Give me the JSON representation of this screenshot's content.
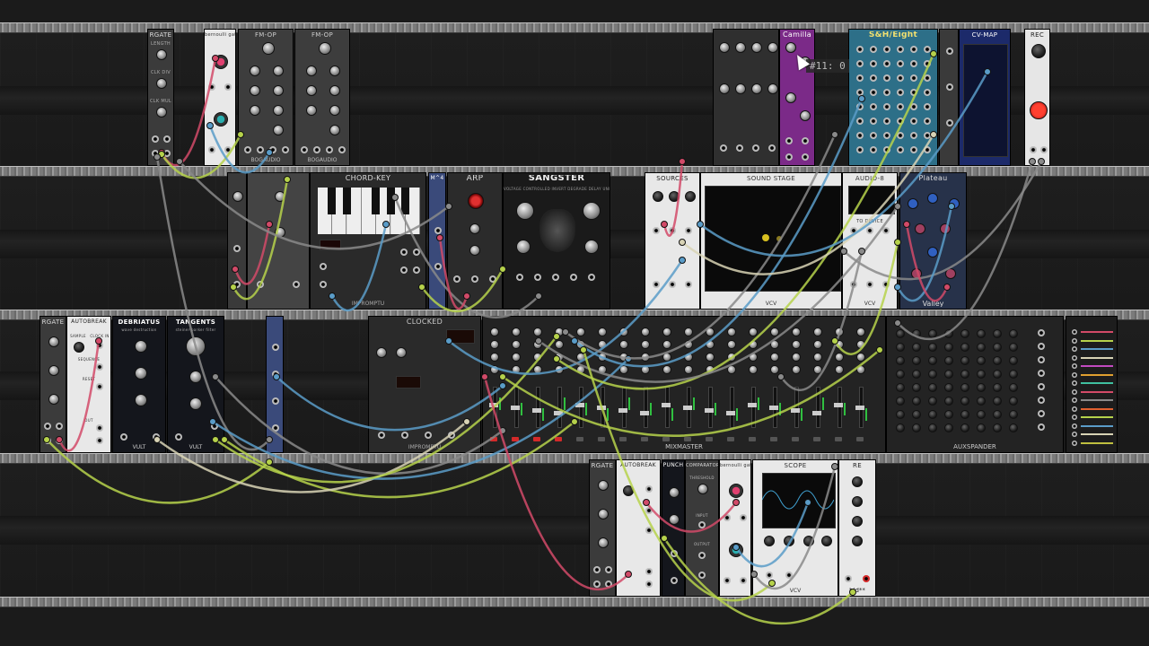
{
  "colors": {
    "cable_red": "#d24a68",
    "cable_green": "#b6d24b",
    "cable_blue": "#5a9cc8",
    "cable_grey": "#8a8a8a",
    "cable_cream": "#d8d3b5",
    "purple": "#7b2a88",
    "red": "#d42a2a"
  },
  "tooltip": "#11: 0",
  "modules": {
    "rgate_top": {
      "title": "RGATE",
      "l1": "LENGTH",
      "l2": "CLK DIV",
      "l3": "CLK MUL"
    },
    "bernoulli_top": {
      "title": "bernoulli gate"
    },
    "fmop_1": {
      "title": "FM-OP",
      "foot": "BOGAUDIO"
    },
    "fmop_2": {
      "title": "FM-OP",
      "foot": "BOGAUDIO"
    },
    "camilla": {
      "title": "Camilla"
    },
    "sh_eight": {
      "title": "S&H/Eight"
    },
    "cvmap": {
      "title": "CV-MAP"
    },
    "rec": {
      "title": "REC"
    },
    "chord_key": {
      "title": "CHORD-KEY",
      "foot": "IMPROMPTU"
    },
    "mm4": {
      "title": "M^4"
    },
    "arp": {
      "title": "ARP"
    },
    "sangster": {
      "title": "SANGSTER",
      "sub": "VOLTAGE CONTROLLED INVERT DEGRADE DELAY UNIT"
    },
    "sources": {
      "title": "SOURCES"
    },
    "sound_stage": {
      "title": "SOUND STAGE",
      "foot": "VCV"
    },
    "audio8": {
      "title": "AUDIO-8",
      "sub": "TO DEVICE",
      "foot": "VCV"
    },
    "plateau": {
      "title": "Plateau",
      "foot": "Valley"
    },
    "rgate_mid": {
      "title": "RGATE"
    },
    "autobreak_mid": {
      "title": "AUTOBREAK",
      "l1": "SAMPLE",
      "l2": "CLOCK IN",
      "l3": "SEQUENCE",
      "l4": "RESET",
      "l5": "OUT"
    },
    "debriatus": {
      "title": "DEBRIATUS",
      "sub": "wave destruction",
      "foot": "VULT"
    },
    "tangents": {
      "title": "TANGENTS",
      "sub": "steiner-parker filter",
      "foot": "VULT"
    },
    "clocked": {
      "title": "CLOCKED",
      "foot": "IMPROMPTU"
    },
    "mixmaster": {
      "title": "MIXMASTER",
      "foot": "MIXMASTER"
    },
    "auxspander": {
      "title": "AUXSPANDER"
    },
    "rgate_bot": {
      "title": "RGATE"
    },
    "autobreak_bot": {
      "title": "AUTOBREAK"
    },
    "punch": {
      "title": "PUNCH"
    },
    "comparator": {
      "title": "COMPARATOR",
      "l1": "THRESHOLD",
      "l2": "INPUT",
      "l3": "OUTPUT"
    },
    "bernoulli_bot": {
      "title": "bernoulli gate"
    },
    "scope": {
      "title": "SCOPE",
      "foot": "VCV"
    },
    "bld": {
      "title": "RE",
      "foot": "bld**"
    }
  }
}
